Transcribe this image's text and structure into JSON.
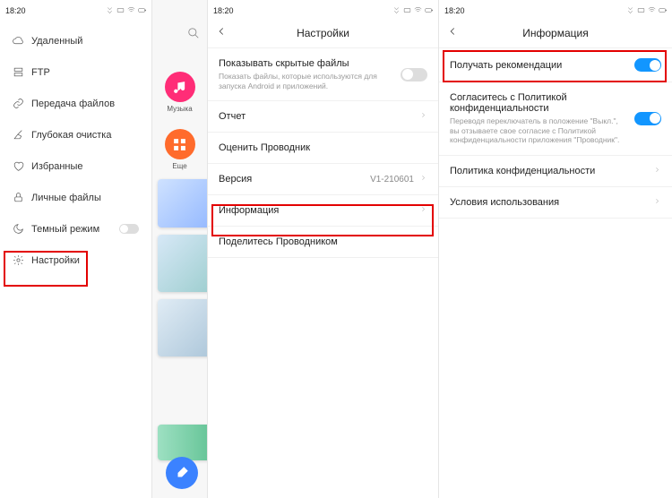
{
  "status": {
    "time": "18:20"
  },
  "screen1": {
    "items": [
      {
        "label": "Удаленный",
        "icon": "cloud"
      },
      {
        "label": "FTP",
        "icon": "ftp"
      },
      {
        "label": "Передача файлов",
        "icon": "link"
      },
      {
        "label": "Глубокая очистка",
        "icon": "broom"
      },
      {
        "label": "Избранные",
        "icon": "heart"
      },
      {
        "label": "Личные файлы",
        "icon": "lock"
      },
      {
        "label": "Темный режим",
        "icon": "moon",
        "toggle": true
      },
      {
        "label": "Настройки",
        "icon": "gear"
      }
    ]
  },
  "screen2": {
    "circles": [
      {
        "label": "Музыка",
        "color": "pink"
      },
      {
        "label": "Еще",
        "color": "orange"
      }
    ]
  },
  "screen3": {
    "title": "Настройки",
    "rows": [
      {
        "label": "Показывать скрытые файлы",
        "sub": "Показать файлы, которые используются для запуска Android и приложений.",
        "type": "toggle",
        "on": false
      },
      {
        "label": "Отчет",
        "type": "chevron"
      },
      {
        "label": "Оценить Проводник",
        "type": "none"
      },
      {
        "label": "Версия",
        "type": "value-chevron",
        "value": "V1-210601"
      },
      {
        "label": "Информация",
        "type": "chevron"
      },
      {
        "label": "Поделитесь Проводником",
        "type": "none"
      }
    ]
  },
  "screen4": {
    "title": "Информация",
    "rows": [
      {
        "label": "Получать рекомендации",
        "type": "toggle",
        "on": true
      },
      {
        "label": "Согласитесь с Политикой конфиденциальности",
        "sub": "Переводя переключатель в положение \"Выкл.\", вы отзываете свое согласие с Политикой конфиденциальности приложения \"Проводник\".",
        "type": "toggle",
        "on": true
      },
      {
        "label": "Политика конфиденциальности",
        "type": "chevron"
      },
      {
        "label": "Условия использования",
        "type": "chevron"
      }
    ]
  }
}
